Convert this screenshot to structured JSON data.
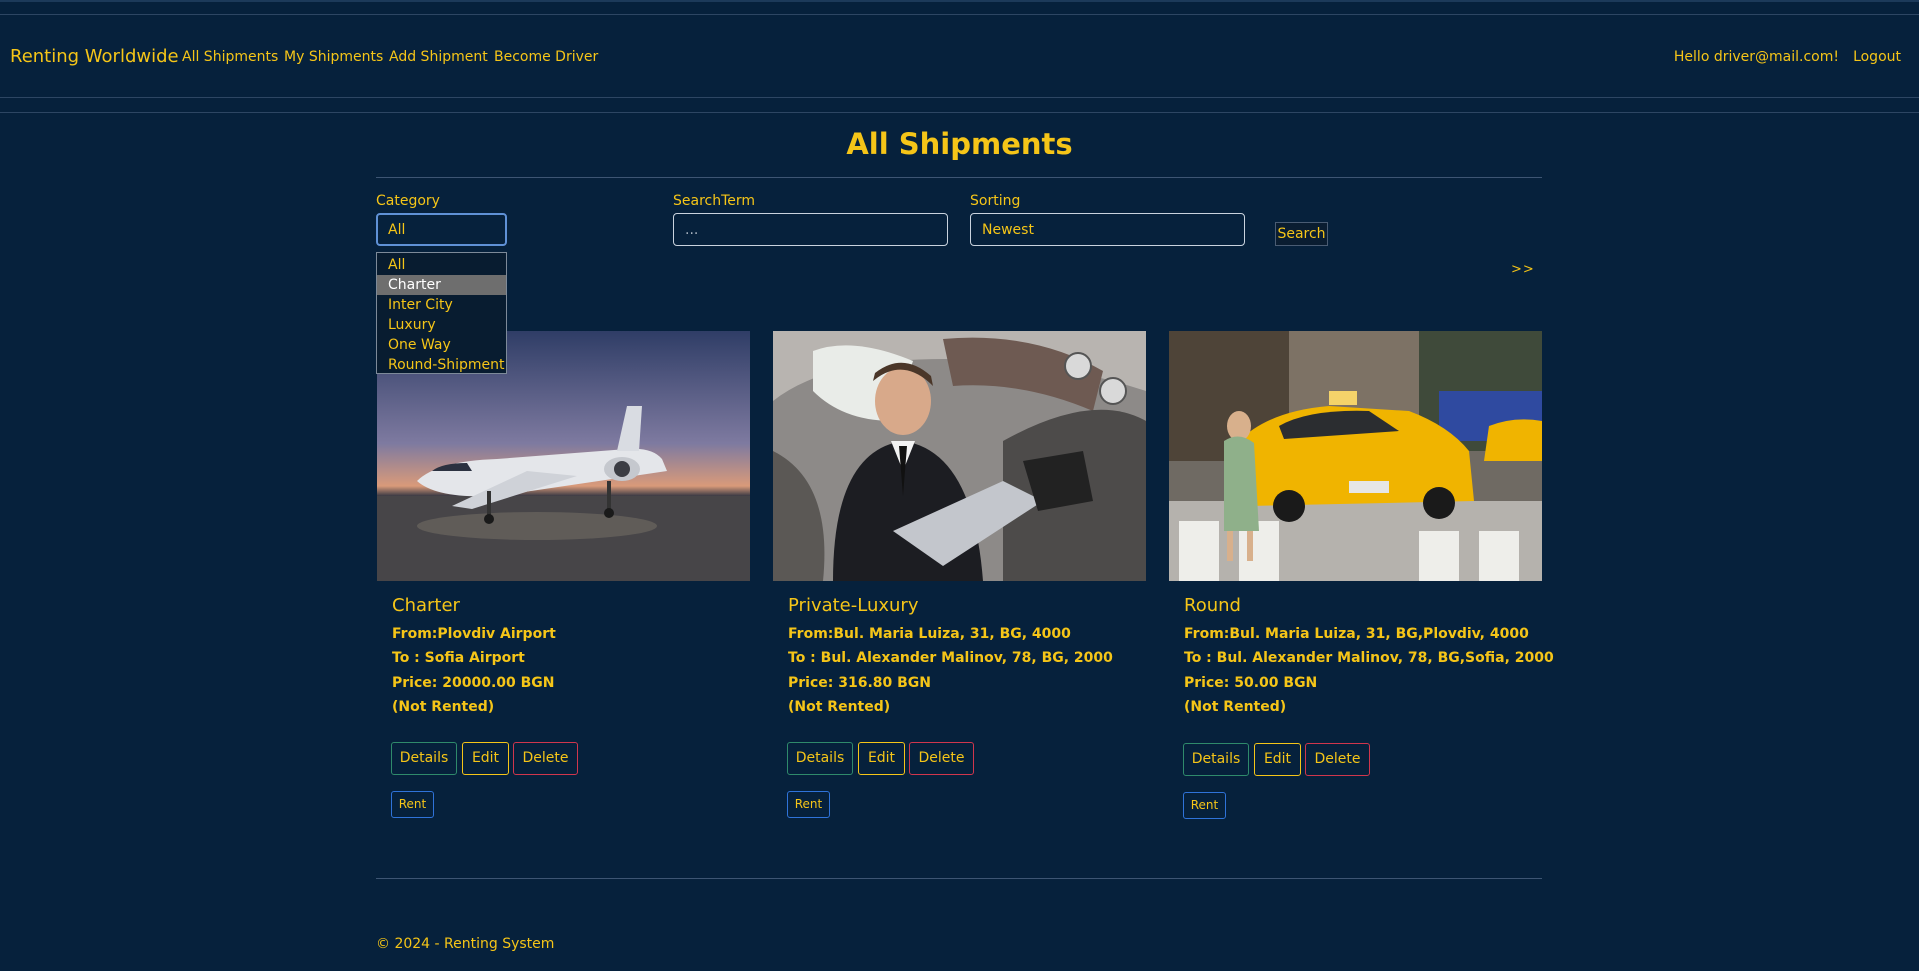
{
  "header": {
    "brand": "Renting Worldwide",
    "nav": [
      "All Shipments",
      "My Shipments",
      "Add Shipment",
      "Become Driver"
    ],
    "greeting": "Hello driver@mail.com!",
    "logout": "Logout"
  },
  "page_title": "All Shipments",
  "filters": {
    "category_label": "Category",
    "category_value": "All",
    "category_options": [
      "All",
      "Charter",
      "Inter City",
      "Luxury",
      "One Way",
      "Round-Shipment"
    ],
    "highlighted_option": "Charter",
    "search_label": "SearchTerm",
    "search_placeholder": "...",
    "sorting_label": "Sorting",
    "sorting_value": "Newest",
    "search_button": "Search",
    "next_page": ">>"
  },
  "cards": [
    {
      "title": "Charter",
      "from_label": "From:",
      "from": "Plovdiv Airport",
      "to_label": "To : ",
      "to": "Sofia Airport",
      "price_label": "Price: ",
      "price": "20000.00 BGN",
      "status": "(Not Rented)",
      "image": "private-jet-photo"
    },
    {
      "title": "Private-Luxury",
      "from_label": "From:",
      "from": "Bul. Maria Luiza, 31, BG, 4000",
      "to_label": "To : ",
      "to": "Bul. Alexander Malinov, 78, BG, 2000",
      "price_label": "Price: ",
      "price": "316.80 BGN",
      "status": "(Not Rented)",
      "image": "businessman-in-limousine-photo"
    },
    {
      "title": "Round",
      "from_label": "From:",
      "from": "Bul. Maria Luiza, 31, BG,Plovdiv, 4000",
      "to_label": "To : ",
      "to": "Bul. Alexander Malinov, 78, BG,Sofia, 2000",
      "price_label": "Price: ",
      "price": "50.00 BGN",
      "status": "(Not Rented)",
      "image": "yellow-taxi-photo"
    }
  ],
  "card_buttons": {
    "details": "Details",
    "edit": "Edit",
    "delete": "Delete",
    "rent": "Rent"
  },
  "footer": "© 2024 - Renting System",
  "colors": {
    "background": "#06213c",
    "text": "#f5c518",
    "details_border": "#2f8a6b",
    "delete_border": "#d0364d",
    "rent_border": "#2f73d9",
    "focus_border": "#5f91d6"
  }
}
